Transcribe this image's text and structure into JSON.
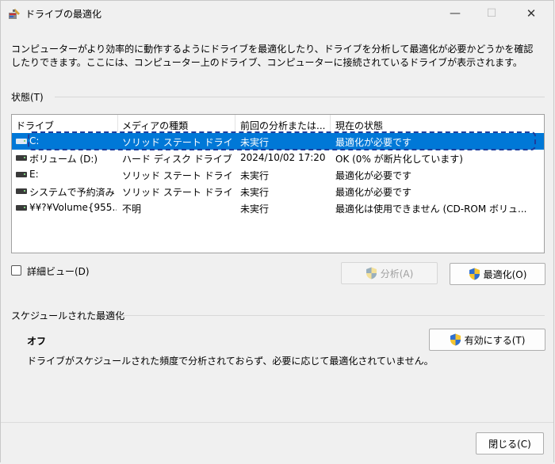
{
  "window": {
    "title": "ドライブの最適化",
    "min_glyph": "—",
    "max_glyph": "☐",
    "close_glyph": "✕"
  },
  "description": "コンピューターがより効率的に動作するようにドライブを最適化したり、ドライブを分析して最適化が必要かどうかを確認したりできます。ここには、コンピューター上のドライブ、コンピューターに接続されているドライブが表示されます。",
  "status_group": {
    "label": "状態(T)",
    "columns": [
      "ドライブ",
      "メディアの種類",
      "前回の分析または...",
      "現在の状態"
    ],
    "rows": [
      {
        "drive": "C:",
        "media": "ソリッド ステート ドライブ",
        "last": "未実行",
        "state": "最適化が必要です",
        "selected": true
      },
      {
        "drive": "ボリューム (D:)",
        "media": "ハード ディスク ドライブ",
        "last": "2024/10/02 17:20",
        "state": "OK (0% が断片化しています)",
        "selected": false
      },
      {
        "drive": "E:",
        "media": "ソリッド ステート ドライブ",
        "last": "未実行",
        "state": "最適化が必要です",
        "selected": false
      },
      {
        "drive": "システムで予約済み",
        "media": "ソリッド ステート ドライブ",
        "last": "未実行",
        "state": "最適化が必要です",
        "selected": false
      },
      {
        "drive": "¥¥?¥Volume{955...",
        "media": "不明",
        "last": "未実行",
        "state": "最適化は使用できません (CD-ROM ボリュ...",
        "selected": false
      }
    ]
  },
  "detail_view": {
    "label": "詳細ビュー(D)",
    "checked": false
  },
  "buttons": {
    "analyze": "分析(A)",
    "optimize": "最適化(O)",
    "enable": "有効にする(T)",
    "close": "閉じる(C)"
  },
  "schedule": {
    "label": "スケジュールされた最適化",
    "status": "オフ",
    "description": "ドライブがスケジュールされた頻度で分析されておらず、必要に応じて最適化されていません。"
  },
  "colors": {
    "selection": "#0078d7",
    "focus_ring": "#1f3c9a"
  }
}
